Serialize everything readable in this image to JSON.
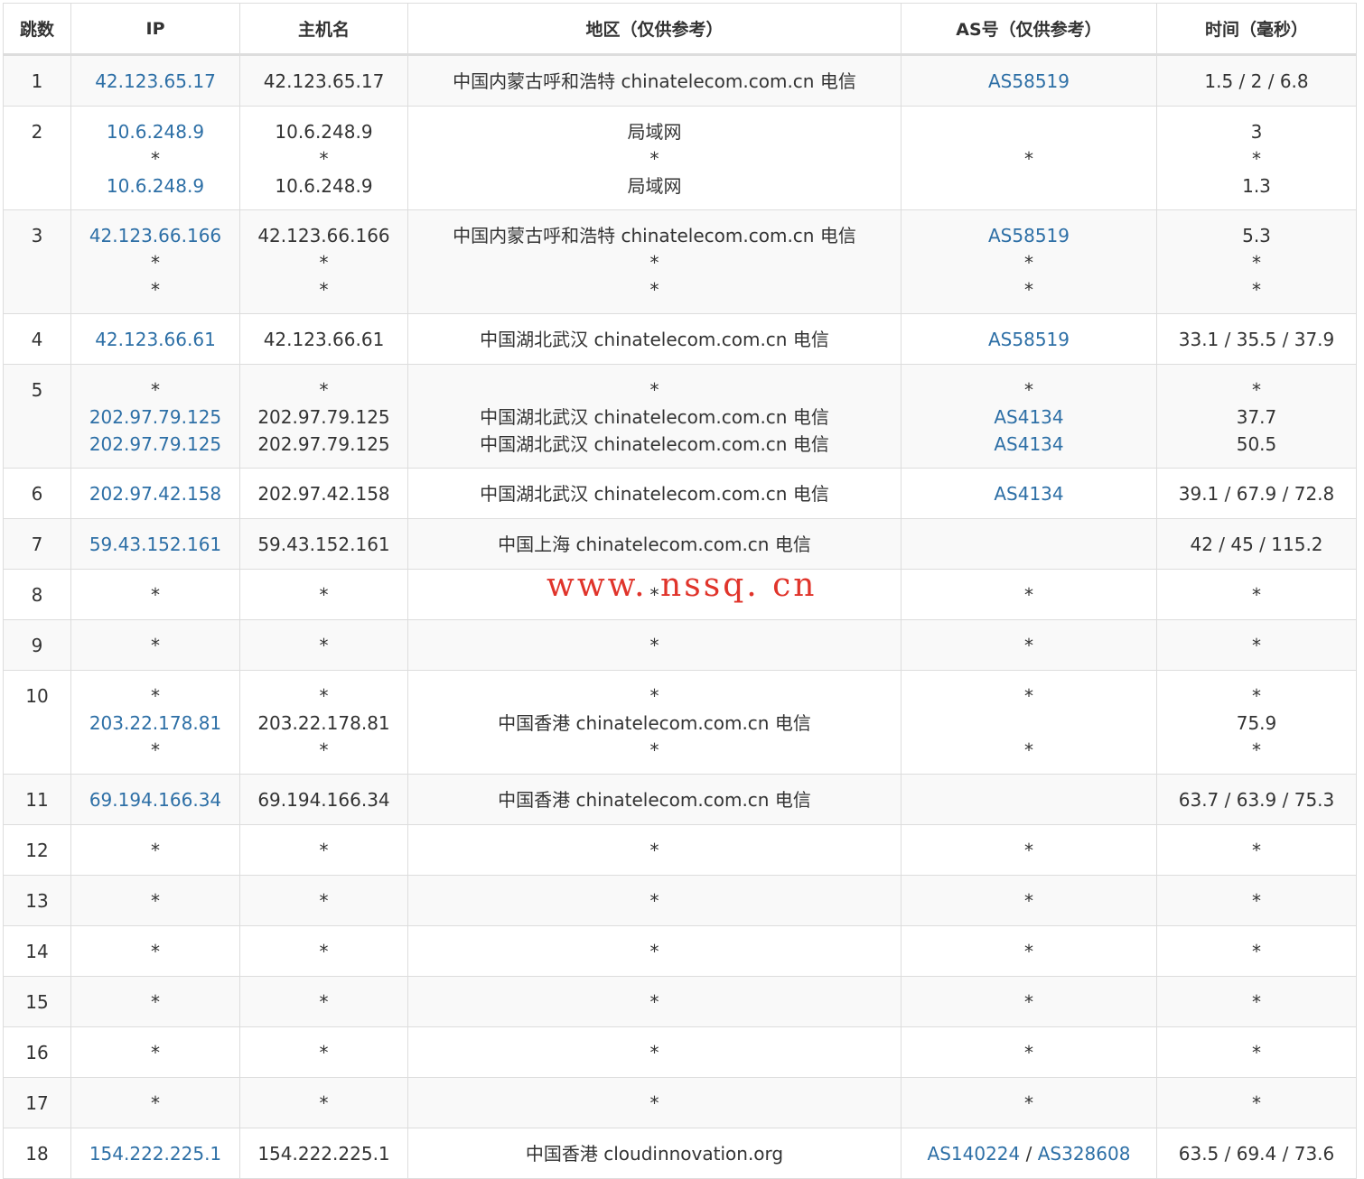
{
  "headers": [
    "跳数",
    "IP",
    "主机名",
    "地区（仅供参考）",
    "AS号（仅供参考）",
    "时间（毫秒）"
  ],
  "watermark": "www. nssq. cn",
  "colors": {
    "link": "#2d6fa6",
    "watermark": "#e0342b",
    "stripe": "#f9f9f9",
    "border": "#dddddd"
  },
  "rows": [
    {
      "hop": "1",
      "ip": [
        "42.123.65.17"
      ],
      "host": [
        "42.123.65.17"
      ],
      "region": [
        "中国内蒙古呼和浩特 chinatelecom.com.cn 电信"
      ],
      "as": [
        [
          "AS58519"
        ]
      ],
      "time": [
        "1.5 / 2 / 6.8"
      ]
    },
    {
      "hop": "2",
      "ip": [
        "10.6.248.9",
        "*",
        "10.6.248.9"
      ],
      "host": [
        "10.6.248.9",
        "*",
        "10.6.248.9"
      ],
      "region": [
        "局域网",
        "*",
        "局域网"
      ],
      "as": [
        [],
        [
          "*"
        ],
        []
      ],
      "time": [
        "3",
        "*",
        "1.3"
      ]
    },
    {
      "hop": "3",
      "ip": [
        "42.123.66.166",
        "*",
        "*"
      ],
      "host": [
        "42.123.66.166",
        "*",
        "*"
      ],
      "region": [
        "中国内蒙古呼和浩特 chinatelecom.com.cn 电信",
        "*",
        "*"
      ],
      "as": [
        [
          "AS58519"
        ],
        [
          "*"
        ],
        [
          "*"
        ]
      ],
      "time": [
        "5.3",
        "*",
        "*"
      ]
    },
    {
      "hop": "4",
      "ip": [
        "42.123.66.61"
      ],
      "host": [
        "42.123.66.61"
      ],
      "region": [
        "中国湖北武汉 chinatelecom.com.cn 电信"
      ],
      "as": [
        [
          "AS58519"
        ]
      ],
      "time": [
        "33.1 / 35.5 / 37.9"
      ]
    },
    {
      "hop": "5",
      "ip": [
        "*",
        "202.97.79.125",
        "202.97.79.125"
      ],
      "host": [
        "*",
        "202.97.79.125",
        "202.97.79.125"
      ],
      "region": [
        "*",
        "中国湖北武汉 chinatelecom.com.cn 电信",
        "中国湖北武汉 chinatelecom.com.cn 电信"
      ],
      "as": [
        [
          "*"
        ],
        [
          "AS4134"
        ],
        [
          "AS4134"
        ]
      ],
      "time": [
        "*",
        "37.7",
        "50.5"
      ]
    },
    {
      "hop": "6",
      "ip": [
        "202.97.42.158"
      ],
      "host": [
        "202.97.42.158"
      ],
      "region": [
        "中国湖北武汉 chinatelecom.com.cn 电信"
      ],
      "as": [
        [
          "AS4134"
        ]
      ],
      "time": [
        "39.1 / 67.9 / 72.8"
      ]
    },
    {
      "hop": "7",
      "ip": [
        "59.43.152.161"
      ],
      "host": [
        "59.43.152.161"
      ],
      "region": [
        "中国上海 chinatelecom.com.cn 电信"
      ],
      "as": [
        []
      ],
      "time": [
        "42 / 45 / 115.2"
      ]
    },
    {
      "hop": "8",
      "ip": [
        "*"
      ],
      "host": [
        "*"
      ],
      "region": [
        "*"
      ],
      "as": [
        [
          "*"
        ]
      ],
      "time": [
        "*"
      ]
    },
    {
      "hop": "9",
      "ip": [
        "*"
      ],
      "host": [
        "*"
      ],
      "region": [
        "*"
      ],
      "as": [
        [
          "*"
        ]
      ],
      "time": [
        "*"
      ]
    },
    {
      "hop": "10",
      "ip": [
        "*",
        "203.22.178.81",
        "*"
      ],
      "host": [
        "*",
        "203.22.178.81",
        "*"
      ],
      "region": [
        "*",
        "中国香港 chinatelecom.com.cn 电信",
        "*"
      ],
      "as": [
        [
          "*"
        ],
        [],
        [
          "*"
        ]
      ],
      "time": [
        "*",
        "75.9",
        "*"
      ]
    },
    {
      "hop": "11",
      "ip": [
        "69.194.166.34"
      ],
      "host": [
        "69.194.166.34"
      ],
      "region": [
        "中国香港 chinatelecom.com.cn 电信"
      ],
      "as": [
        []
      ],
      "time": [
        "63.7 / 63.9 / 75.3"
      ]
    },
    {
      "hop": "12",
      "ip": [
        "*"
      ],
      "host": [
        "*"
      ],
      "region": [
        "*"
      ],
      "as": [
        [
          "*"
        ]
      ],
      "time": [
        "*"
      ]
    },
    {
      "hop": "13",
      "ip": [
        "*"
      ],
      "host": [
        "*"
      ],
      "region": [
        "*"
      ],
      "as": [
        [
          "*"
        ]
      ],
      "time": [
        "*"
      ]
    },
    {
      "hop": "14",
      "ip": [
        "*"
      ],
      "host": [
        "*"
      ],
      "region": [
        "*"
      ],
      "as": [
        [
          "*"
        ]
      ],
      "time": [
        "*"
      ]
    },
    {
      "hop": "15",
      "ip": [
        "*"
      ],
      "host": [
        "*"
      ],
      "region": [
        "*"
      ],
      "as": [
        [
          "*"
        ]
      ],
      "time": [
        "*"
      ]
    },
    {
      "hop": "16",
      "ip": [
        "*"
      ],
      "host": [
        "*"
      ],
      "region": [
        "*"
      ],
      "as": [
        [
          "*"
        ]
      ],
      "time": [
        "*"
      ]
    },
    {
      "hop": "17",
      "ip": [
        "*"
      ],
      "host": [
        "*"
      ],
      "region": [
        "*"
      ],
      "as": [
        [
          "*"
        ]
      ],
      "time": [
        "*"
      ]
    },
    {
      "hop": "18",
      "ip": [
        "154.222.225.1"
      ],
      "host": [
        "154.222.225.1"
      ],
      "region": [
        "中国香港 cloudinnovation.org"
      ],
      "as": [
        [
          "AS140224",
          "AS328608"
        ]
      ],
      "time": [
        "63.5 / 69.4 / 73.6"
      ]
    }
  ]
}
